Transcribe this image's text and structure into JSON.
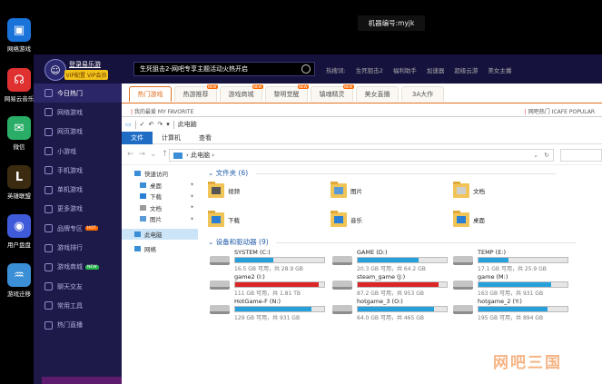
{
  "desktop": {
    "icons": [
      {
        "label": "网络游戏",
        "glyph": "▣",
        "color": "#1a73d9"
      },
      {
        "label": "网易云音乐",
        "glyph": "☊",
        "color": "#e03131"
      },
      {
        "label": "微信",
        "glyph": "✉",
        "color": "#2aae67"
      },
      {
        "label": "英雄联盟",
        "glyph": "L",
        "color": "#3b2b10"
      },
      {
        "label": "用户盘盘",
        "glyph": "◉",
        "color": "#3f5bd9"
      },
      {
        "label": "游戏迁移",
        "glyph": "♒",
        "color": "#3a8fd6"
      }
    ],
    "machine_id": "机器编号:myjk"
  },
  "launcher": {
    "login_label": "登录易乐游",
    "vip_label": "VIP配置 VIP会员",
    "search_text": "生死狙击2-网吧专享主题活动火热开启",
    "hot_search": [
      "热搜词:",
      "生死狙击2",
      "福利助手",
      "加速器",
      "超级云游",
      "美女主播"
    ],
    "sidebar": [
      {
        "label": "今日热门",
        "active": true,
        "badge": ""
      },
      {
        "label": "网络游戏",
        "active": false,
        "badge": ""
      },
      {
        "label": "网页游戏",
        "active": false,
        "badge": ""
      },
      {
        "label": "小游戏",
        "active": false,
        "badge": ""
      },
      {
        "label": "手机游戏",
        "active": false,
        "badge": ""
      },
      {
        "label": "单机游戏",
        "active": false,
        "badge": ""
      },
      {
        "label": "更多游戏",
        "active": false,
        "badge": ""
      },
      {
        "label": "品牌专区",
        "active": false,
        "badge": "HOT"
      },
      {
        "label": "游戏排行",
        "active": false,
        "badge": ""
      },
      {
        "label": "游戏商城",
        "active": false,
        "badge": "NEW"
      },
      {
        "label": "聊天交友",
        "active": false,
        "badge": ""
      },
      {
        "label": "常用工具",
        "active": false,
        "badge": ""
      },
      {
        "label": "热门直播",
        "active": false,
        "badge": ""
      }
    ],
    "tabs": [
      {
        "label": "热门游戏",
        "active": true,
        "new": false
      },
      {
        "label": "热游推荐",
        "active": false,
        "new": true
      },
      {
        "label": "游戏商城",
        "active": false,
        "new": true
      },
      {
        "label": "黎明觉醒",
        "active": false,
        "new": true
      },
      {
        "label": "镇魂精灵",
        "active": false,
        "new": true
      },
      {
        "label": "美女直播",
        "active": false,
        "new": false
      },
      {
        "label": "3A大作",
        "active": false,
        "new": false
      }
    ],
    "fav_left_mark": "|",
    "fav_left": "我的最爱",
    "fav_left_sub": "MY FAVORITE",
    "fav_right_mark": "|",
    "fav_right": "网吧热门",
    "fav_right_sub": "ICAFE POPULAR"
  },
  "explorer": {
    "title": "此电脑",
    "ribbon_tabs": [
      "文件",
      "计算机",
      "查看"
    ],
    "path": "此电脑",
    "tree": [
      {
        "label": "快速访问",
        "level": 0,
        "pin": false,
        "selected": false,
        "icon": "star-icon"
      },
      {
        "label": "桌面",
        "level": 1,
        "pin": true,
        "selected": false,
        "icon": "desktop-icon"
      },
      {
        "label": "下载",
        "level": 1,
        "pin": true,
        "selected": false,
        "icon": "download-icon"
      },
      {
        "label": "文档",
        "level": 1,
        "pin": true,
        "selected": false,
        "icon": "document-icon"
      },
      {
        "label": "图片",
        "level": 1,
        "pin": true,
        "selected": false,
        "icon": "picture-icon"
      },
      {
        "label": "此电脑",
        "level": 0,
        "pin": false,
        "selected": true,
        "icon": "pc-icon"
      },
      {
        "label": "网络",
        "level": 0,
        "pin": false,
        "selected": false,
        "icon": "network-icon"
      }
    ],
    "folders_header": "文件夹 (6)",
    "folders": [
      {
        "label": "视频",
        "icon": "video-folder-icon",
        "accent": "#555"
      },
      {
        "label": "图片",
        "icon": "picture-folder-icon",
        "accent": "#5a9bd5"
      },
      {
        "label": "文档",
        "icon": "document-folder-icon",
        "accent": "#cfcfcf"
      },
      {
        "label": "下载",
        "icon": "download-folder-icon",
        "accent": "#2a7fd4"
      },
      {
        "label": "音乐",
        "icon": "music-folder-icon",
        "accent": "#2a7fd4"
      },
      {
        "label": "桌面",
        "icon": "desktop-folder-icon",
        "accent": "#2a7fd4"
      }
    ],
    "drives_header": "设备和驱动器 (9)",
    "drives": [
      {
        "name": "SYSTEM (C:)",
        "free": "16.5 GB 可用，共 28.9 GB",
        "used": 0.43,
        "critical": false,
        "system": true
      },
      {
        "name": "GAME (D:)",
        "free": "20.3 GB 可用，共 64.2 GB",
        "used": 0.68,
        "critical": false,
        "system": false
      },
      {
        "name": "TEMP (E:)",
        "free": "17.1 GB 可用，共 25.9 GB",
        "used": 0.34,
        "critical": false,
        "system": false
      },
      {
        "name": "game2 (I:)",
        "free": "111 GB 可用，共 1.81 TB",
        "used": 0.94,
        "critical": true,
        "system": false
      },
      {
        "name": "steam_game (J:)",
        "free": "87.2 GB 可用，共 953 GB",
        "used": 0.91,
        "critical": true,
        "system": false
      },
      {
        "name": "game (M:)",
        "free": "163 GB 可用，共 931 GB",
        "used": 0.82,
        "critical": false,
        "system": false
      },
      {
        "name": "HotGame-F (N:)",
        "free": "129 GB 可用，共 931 GB",
        "used": 0.86,
        "critical": false,
        "system": false
      },
      {
        "name": "hotgame_3 (O:)",
        "free": "64.0 GB 可用，共 465 GB",
        "used": 0.86,
        "critical": false,
        "system": false
      },
      {
        "name": "hotgame_2 (Y:)",
        "free": "195 GB 可用，共 894 GB",
        "used": 0.78,
        "critical": false,
        "system": false
      }
    ]
  },
  "watermark": "网吧三国"
}
